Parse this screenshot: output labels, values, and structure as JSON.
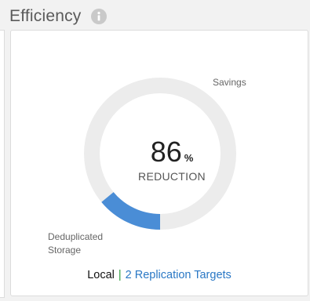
{
  "panel": {
    "title": "Efficiency",
    "info_icon": "info-icon"
  },
  "efficiency": {
    "reduction_value": "86",
    "reduction_unit": "%",
    "reduction_label": "REDUCTION",
    "savings_label": "Savings",
    "dedup_label_line1": "Deduplicated",
    "dedup_label_line2": "Storage",
    "deduplicated_fraction": 0.14
  },
  "footer": {
    "local_label": "Local",
    "separator": "|",
    "replication_link": "2  Replication Targets"
  },
  "colors": {
    "savings_ring": "#ececec",
    "dedup_arc": "#4a8dd6",
    "link": "#2a78c5",
    "separator": "#2e9d3f"
  }
}
